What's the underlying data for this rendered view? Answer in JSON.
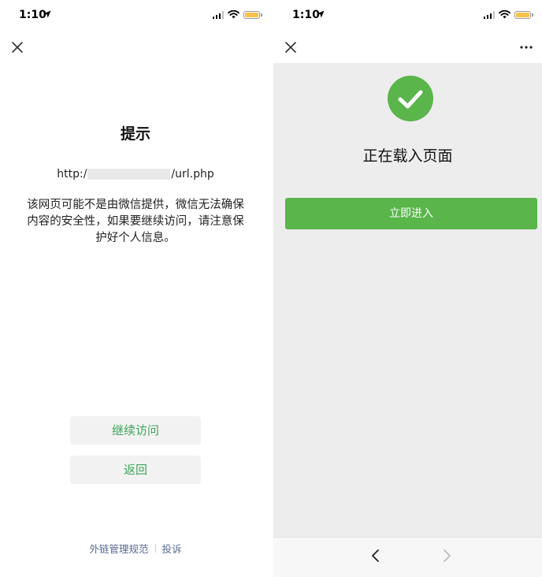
{
  "status_bar": {
    "time": "1:10",
    "battery_color": "#f7c24a"
  },
  "left_screen": {
    "close_icon": "close-icon",
    "title": "提示",
    "url_prefix": "http:/",
    "url_suffix": "/url.php",
    "warning_text": "该网页可能不是由微信提供，微信无法确保内容的安全性，如果要继续访问，请注意保护好个人信息。",
    "continue_label": "继续访问",
    "back_label": "返回",
    "footer_link_policy": "外链管理规范",
    "footer_link_report": "投诉",
    "accent_color": "#3ea55b",
    "link_color": "#576b95"
  },
  "right_screen": {
    "close_icon": "close-icon",
    "more_icon": "more-icon",
    "success_icon": "check-circle-icon",
    "loading_text": "正在载入页面",
    "enter_label": "立即进入",
    "button_color": "#5ab54b",
    "back_icon": "chevron-left-icon",
    "forward_icon": "chevron-right-icon"
  }
}
